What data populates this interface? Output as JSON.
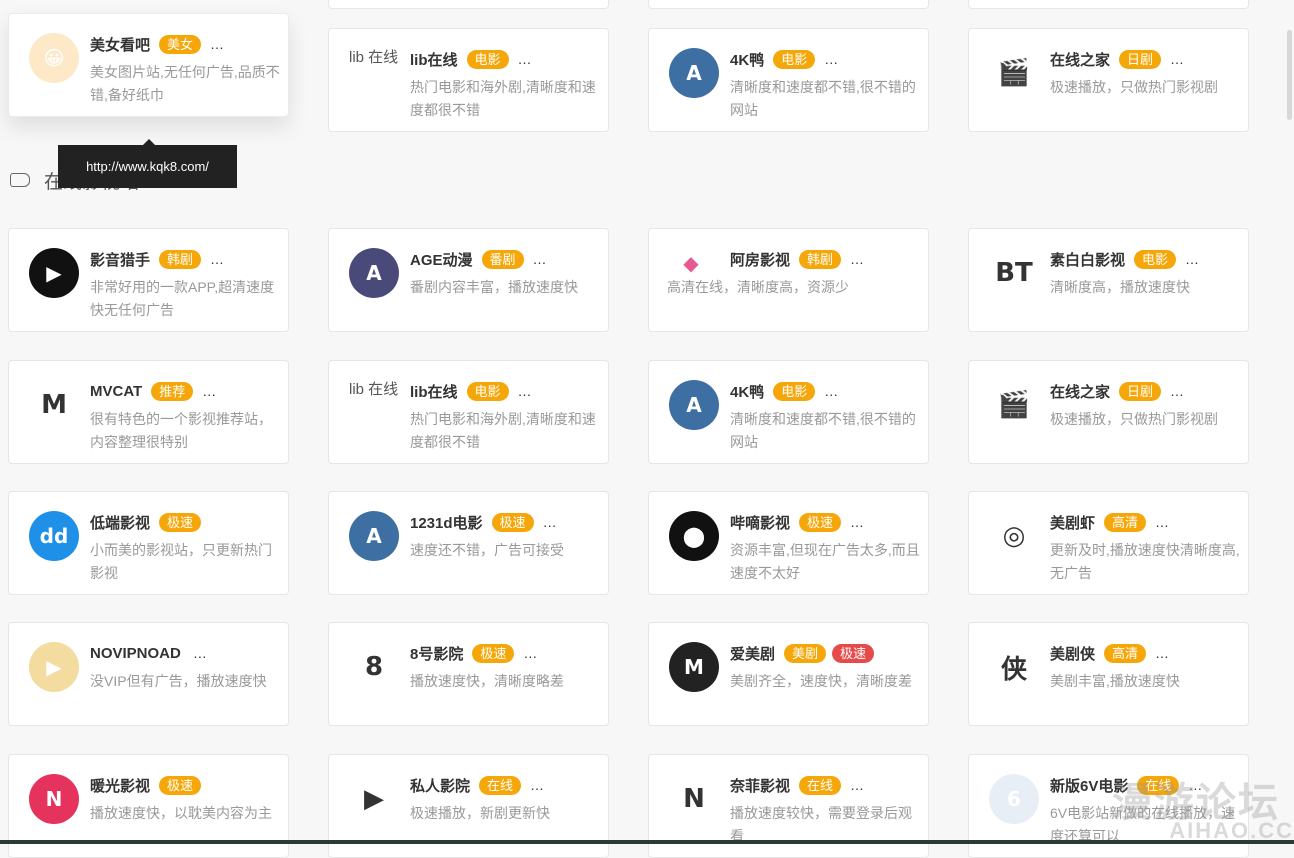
{
  "tooltip": "http://www.kqk8.com/",
  "section_title": "在线影视站",
  "cards": [
    {
      "name": "美女看吧",
      "tags": [
        {
          "t": "美女"
        }
      ],
      "desc": "美女图片站,无任何广告,品质不错,备好纸巾",
      "icon": "cartoon-girl-icon",
      "logo": "😀",
      "bg": "#fde9c8"
    },
    {
      "name": "lib在线",
      "tags": [
        {
          "t": "电影"
        }
      ],
      "desc": "热门电影和海外剧,清晰度和速度都很不错",
      "icon": "broken-image-icon",
      "logo": "lib 在线",
      "broken": true
    },
    {
      "name": "4K鸭",
      "tags": [
        {
          "t": "电影"
        }
      ],
      "desc": "清晰度和速度都不错,很不错的网站",
      "icon": "arrow-a-icon",
      "logo": "A",
      "bg": "#3d6fa3"
    },
    {
      "name": "在线之家",
      "tags": [
        {
          "t": "日剧"
        }
      ],
      "desc": "极速播放，只做热门影视剧",
      "icon": "clapperboard-icon",
      "logo": "🎬",
      "plain": true
    },
    {
      "name": "影音猎手",
      "tags": [
        {
          "t": "韩剧"
        }
      ],
      "desc": "非常好用的一款APP,超清速度快无任何广告",
      "icon": "play-button-icon",
      "logo": "▶",
      "bg": "#111"
    },
    {
      "name": "AGE动漫",
      "tags": [
        {
          "t": "番剧"
        }
      ],
      "desc": "番剧内容丰富，播放速度快",
      "icon": "anime-avatar-icon",
      "logo": "A",
      "bg": "#4a4a7a"
    },
    {
      "name": "阿房影视",
      "tags": [
        {
          "t": "韩剧"
        }
      ],
      "desc": "高清在线，清晰度高，资源少",
      "icon": "epang-logo-icon",
      "logo": "◆",
      "plain": true,
      "wide": true
    },
    {
      "name": "素白白影视",
      "tags": [
        {
          "t": "电影"
        }
      ],
      "desc": "清晰度高，播放速度快",
      "icon": "bt-logo-icon",
      "logo": "BT",
      "plain": true
    },
    {
      "name": "MVCAT",
      "tags": [
        {
          "t": "推荐"
        }
      ],
      "desc": "很有特色的一个影视推荐站，内容整理很特别",
      "icon": "mvcat-logo-icon",
      "logo": "M",
      "plain": true
    },
    {
      "name": "lib在线",
      "tags": [
        {
          "t": "电影"
        }
      ],
      "desc": "热门电影和海外剧,清晰度和速度都很不错",
      "icon": "broken-image-icon",
      "logo": "lib 在线",
      "broken": true
    },
    {
      "name": "4K鸭",
      "tags": [
        {
          "t": "电影"
        }
      ],
      "desc": "清晰度和速度都不错,很不错的网站",
      "icon": "arrow-a-icon",
      "logo": "A",
      "bg": "#3d6fa3"
    },
    {
      "name": "在线之家",
      "tags": [
        {
          "t": "日剧"
        }
      ],
      "desc": "极速播放，只做热门影视剧",
      "icon": "clapperboard-icon",
      "logo": "🎬",
      "plain": true
    },
    {
      "name": "低端影视",
      "tags": [
        {
          "t": "极速"
        }
      ],
      "desc": "小而美的影视站，只更新热门影视",
      "icon": "dd-logo-icon",
      "logo": "dd",
      "bg": "#1e90e8",
      "nomore": true
    },
    {
      "name": "1231d电影",
      "tags": [
        {
          "t": "极速"
        }
      ],
      "desc": "速度还不错，广告可接受",
      "icon": "arrow-a-icon",
      "logo": "A",
      "bg": "#3d6fa3"
    },
    {
      "name": "哔嘀影视",
      "tags": [
        {
          "t": "极速"
        }
      ],
      "desc": "资源丰富,但现在广告太多,而且速度不太好",
      "icon": "film-reel-icon",
      "logo": "⬤",
      "bg": "#111"
    },
    {
      "name": "美剧虾",
      "tags": [
        {
          "t": "高清"
        }
      ],
      "desc": "更新及时,播放速度快清晰度高,无广告",
      "icon": "film-roll-icon",
      "logo": "◎",
      "plain": true
    },
    {
      "name": "NOVIPNOAD",
      "tags": [],
      "desc": "没VIP但有广告，播放速度快",
      "icon": "play-octagon-icon",
      "logo": "▶",
      "bg": "#f4dba0"
    },
    {
      "name": "8号影院",
      "tags": [
        {
          "t": "极速"
        }
      ],
      "desc": "播放速度快，清晰度略差",
      "icon": "bird-mascot-icon",
      "logo": "8",
      "plain": true
    },
    {
      "name": "爱美剧",
      "tags": [
        {
          "t": "美剧"
        },
        {
          "t": "极速",
          "red": true
        }
      ],
      "desc": "美剧齐全，速度快，清晰度差",
      "icon": "m-logo-icon",
      "logo": "M",
      "bg": "#222",
      "nomore": true
    },
    {
      "name": "美剧侠",
      "tags": [
        {
          "t": "高清"
        }
      ],
      "desc": "美剧丰富,播放速度快",
      "icon": "xia-seal-icon",
      "logo": "侠",
      "plain": true
    },
    {
      "name": "暖光影视",
      "tags": [
        {
          "t": "极速"
        }
      ],
      "desc": "播放速度快，以耽美内容为主",
      "icon": "n-logo-icon",
      "logo": "N",
      "bg": "#e6335e",
      "nomore": true
    },
    {
      "name": "私人影院",
      "tags": [
        {
          "t": "在线"
        }
      ],
      "desc": "极速播放，新剧更新快",
      "icon": "colorful-play-icon",
      "logo": "▶",
      "plain": true
    },
    {
      "name": "奈菲影视",
      "tags": [
        {
          "t": "在线"
        }
      ],
      "desc": "播放速度较快，需要登录后观看",
      "icon": "netflix-n-icon",
      "logo": "N",
      "plain": true
    },
    {
      "name": "新版6V电影",
      "tags": [
        {
          "t": "在线"
        }
      ],
      "desc": "6V电影站新做的在线播放，速度还算可以",
      "icon": "six-logo-icon",
      "logo": "6",
      "bg": "#e8eef5"
    }
  ],
  "watermark": "漫游论坛",
  "watermark_sub": "AIHAO.CC",
  "colors": {
    "tag": "#f5a70a",
    "tag_red": "#e64b4b"
  }
}
